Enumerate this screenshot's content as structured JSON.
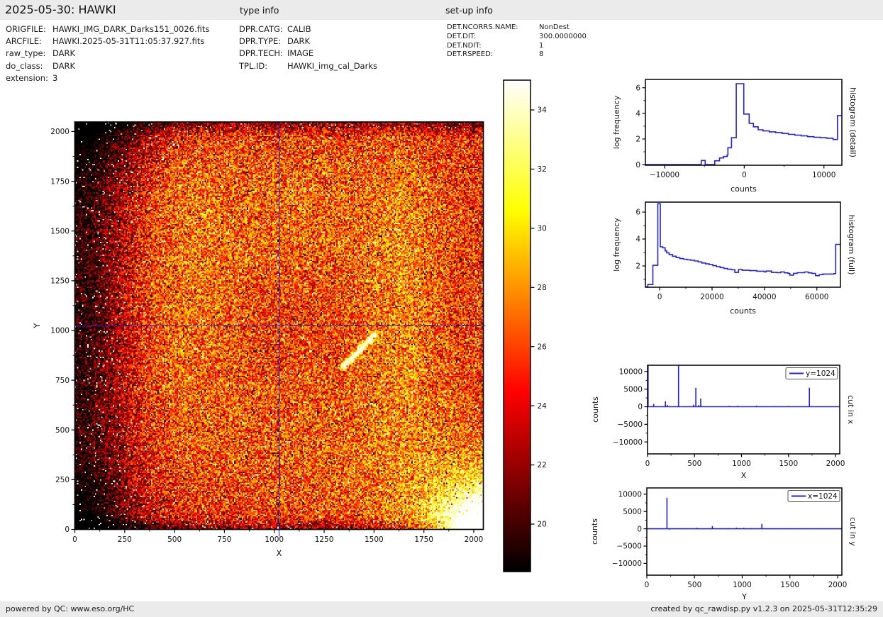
{
  "header": {
    "title": "2025-05-30: HAWKI",
    "type_info_label": "type info",
    "setup_info_label": "set-up info"
  },
  "file_info": {
    "rows": [
      {
        "label": "ORIGFILE:",
        "value": "HAWKI_IMG_DARK_Darks151_0026.fits"
      },
      {
        "label": "ARCFILE:",
        "value": "HAWKI.2025-05-31T11:05:37.927.fits"
      },
      {
        "label": "raw_type:",
        "value": "DARK"
      },
      {
        "label": "do_class:",
        "value": "DARK"
      },
      {
        "label": "extension:",
        "value": "3"
      }
    ]
  },
  "type_info": {
    "rows": [
      {
        "label": "DPR.CATG:",
        "value": "CALIB"
      },
      {
        "label": "DPR.TYPE:",
        "value": "DARK"
      },
      {
        "label": "DPR.TECH:",
        "value": "IMAGE"
      },
      {
        "label": "TPL.ID:",
        "value": "HAWKI_img_cal_Darks"
      }
    ]
  },
  "setup_info": {
    "rows": [
      {
        "label": "DET.NCORRS.NAME:",
        "value": "NonDest"
      },
      {
        "label": "DET.DIT:",
        "value": "300.0000000"
      },
      {
        "label": "DET.NDIT:",
        "value": "1"
      },
      {
        "label": "DET.RSPEED:",
        "value": "8"
      }
    ]
  },
  "footer": {
    "left": "powered by QC: www.eso.org/HC",
    "right": "created by qc_rawdisp.py v1.2.3 on 2025-05-31T12:35:29"
  },
  "colors": {
    "line_blue": "#2222dd",
    "crosshair_blue": "#2222cc",
    "bar_gray": "#ebebeb",
    "axis_black": "#000000"
  },
  "chart_data": [
    {
      "id": "raw_frame",
      "type": "heatmap",
      "xlabel": "X",
      "ylabel": "Y",
      "xlim": [
        0,
        2048
      ],
      "ylim": [
        0,
        2048
      ],
      "xticks": [
        0,
        250,
        500,
        750,
        1000,
        1250,
        1500,
        1750,
        2000
      ],
      "yticks": [
        0,
        250,
        500,
        750,
        1000,
        1250,
        1500,
        1750,
        2000
      ],
      "xticks_minor": [
        125,
        375,
        625,
        875,
        1125,
        1375,
        1625,
        1875
      ],
      "yticks_minor": [
        125,
        375,
        625,
        875,
        1125,
        1375,
        1625,
        1875
      ],
      "colormap": "hot",
      "crosshair": {
        "x": 1024,
        "y": 1024
      },
      "colorbar": {
        "ticks": [
          20,
          22,
          24,
          26,
          28,
          30,
          32,
          34
        ],
        "vmin": 18.4,
        "vmax": 35.0
      },
      "features": [
        "noisy dark frame, orange/red mottled field with hot-pixel speckles",
        "dark band along left edge and dark top/bottom borders",
        "dark top-left and bottom-left corners",
        "bright vertical band around x=350-800",
        "bright band near x=1650",
        "saturated white blob in bottom-right corner",
        "diagonal bright streak from about (1350,820) to (1505,975)"
      ]
    },
    {
      "id": "hist_detail",
      "type": "line",
      "side_label": "histogram (detail)",
      "xlabel": "counts",
      "ylabel": "log frequency",
      "xlim": [
        -12400,
        12250
      ],
      "ylim": [
        -0.05,
        6.65
      ],
      "xticks": [
        -10000,
        0,
        10000
      ],
      "xticks_minor": [
        -5000,
        5000
      ],
      "yticks": [
        0,
        2,
        4,
        6
      ],
      "yticks_minor": [
        1,
        3,
        5
      ],
      "series": [
        {
          "name": "histogram",
          "points": [
            [
              -12400,
              0
            ],
            [
              -5400,
              0
            ],
            [
              -5400,
              0.32
            ],
            [
              -4900,
              0.32
            ],
            [
              -4900,
              0
            ],
            [
              -3700,
              0
            ],
            [
              -3700,
              0.3
            ],
            [
              -3100,
              0.3
            ],
            [
              -3100,
              0.52
            ],
            [
              -2600,
              0.52
            ],
            [
              -2600,
              0.63
            ],
            [
              -2150,
              0.63
            ],
            [
              -2150,
              0.74
            ],
            [
              -2050,
              0.74
            ],
            [
              -2050,
              1.32
            ],
            [
              -1600,
              1.32
            ],
            [
              -1600,
              2.1
            ],
            [
              -1000,
              2.1
            ],
            [
              -1000,
              6.32
            ],
            [
              -60,
              6.32
            ],
            [
              -60,
              3.95
            ],
            [
              620,
              3.95
            ],
            [
              620,
              3.22
            ],
            [
              1150,
              3.22
            ],
            [
              1150,
              2.95
            ],
            [
              1750,
              2.95
            ],
            [
              1750,
              2.72
            ],
            [
              2350,
              2.72
            ],
            [
              2350,
              2.63
            ],
            [
              3150,
              2.63
            ],
            [
              3150,
              2.56
            ],
            [
              3950,
              2.56
            ],
            [
              3950,
              2.5
            ],
            [
              4750,
              2.5
            ],
            [
              4750,
              2.43
            ],
            [
              5550,
              2.43
            ],
            [
              5550,
              2.36
            ],
            [
              6350,
              2.36
            ],
            [
              6350,
              2.3
            ],
            [
              7150,
              2.3
            ],
            [
              7150,
              2.24
            ],
            [
              7950,
              2.24
            ],
            [
              7950,
              2.18
            ],
            [
              8750,
              2.18
            ],
            [
              8750,
              2.13
            ],
            [
              9550,
              2.13
            ],
            [
              9550,
              2.1
            ],
            [
              10350,
              2.1
            ],
            [
              10350,
              2.06
            ],
            [
              11150,
              2.06
            ],
            [
              11150,
              1.96
            ],
            [
              11700,
              1.96
            ],
            [
              11700,
              3.82
            ],
            [
              12250,
              3.82
            ]
          ]
        }
      ]
    },
    {
      "id": "hist_full",
      "type": "line",
      "side_label": "histogram (full)",
      "xlabel": "counts",
      "ylabel": "log frequency",
      "xlim": [
        -5430,
        69000
      ],
      "ylim": [
        0.42,
        6.74
      ],
      "xticks": [
        0,
        20000,
        40000,
        60000
      ],
      "xticks_minor": [
        10000,
        30000,
        50000
      ],
      "yticks": [
        2,
        4,
        6
      ],
      "yticks_minor": [
        1,
        3,
        5
      ],
      "series": [
        {
          "name": "histogram",
          "points": [
            [
              -5400,
              0.45
            ],
            [
              -4500,
              0.45
            ],
            [
              -4500,
              0.62
            ],
            [
              -2600,
              0.62
            ],
            [
              -2600,
              2.05
            ],
            [
              -700,
              2.05
            ],
            [
              -700,
              6.62
            ],
            [
              250,
              6.62
            ],
            [
              250,
              3.42
            ],
            [
              1200,
              3.42
            ],
            [
              1200,
              3.35
            ],
            [
              2100,
              3.35
            ],
            [
              2100,
              3.12
            ],
            [
              2700,
              3.12
            ],
            [
              2700,
              2.98
            ],
            [
              3600,
              2.98
            ],
            [
              3600,
              2.85
            ],
            [
              4900,
              2.85
            ],
            [
              4900,
              2.72
            ],
            [
              6300,
              2.72
            ],
            [
              6300,
              2.62
            ],
            [
              7700,
              2.62
            ],
            [
              7700,
              2.55
            ],
            [
              9100,
              2.55
            ],
            [
              9100,
              2.5
            ],
            [
              10500,
              2.5
            ],
            [
              10500,
              2.46
            ],
            [
              11900,
              2.46
            ],
            [
              11900,
              2.42
            ],
            [
              13300,
              2.42
            ],
            [
              13300,
              2.37
            ],
            [
              14700,
              2.37
            ],
            [
              14700,
              2.3
            ],
            [
              16100,
              2.3
            ],
            [
              16100,
              2.22
            ],
            [
              17500,
              2.22
            ],
            [
              17500,
              2.16
            ],
            [
              18900,
              2.16
            ],
            [
              18900,
              2.1
            ],
            [
              20300,
              2.1
            ],
            [
              20300,
              2.02
            ],
            [
              21700,
              2.02
            ],
            [
              21700,
              1.95
            ],
            [
              23100,
              1.95
            ],
            [
              23100,
              1.88
            ],
            [
              24500,
              1.88
            ],
            [
              24500,
              1.81
            ],
            [
              25900,
              1.81
            ],
            [
              25900,
              1.76
            ],
            [
              27300,
              1.76
            ],
            [
              27300,
              1.72
            ],
            [
              28700,
              1.72
            ],
            [
              28700,
              1.52
            ],
            [
              30100,
              1.52
            ],
            [
              30100,
              1.74
            ],
            [
              31500,
              1.74
            ],
            [
              31500,
              1.68
            ],
            [
              34300,
              1.68
            ],
            [
              34300,
              1.65
            ],
            [
              37100,
              1.65
            ],
            [
              37100,
              1.61
            ],
            [
              39900,
              1.61
            ],
            [
              39900,
              1.55
            ],
            [
              40600,
              1.55
            ],
            [
              40600,
              1.62
            ],
            [
              42700,
              1.62
            ],
            [
              42700,
              1.52
            ],
            [
              44800,
              1.52
            ],
            [
              44800,
              1.5
            ],
            [
              46200,
              1.5
            ],
            [
              46200,
              1.56
            ],
            [
              47600,
              1.56
            ],
            [
              47600,
              1.49
            ],
            [
              49000,
              1.49
            ],
            [
              49000,
              1.44
            ],
            [
              49700,
              1.44
            ],
            [
              49700,
              1.32
            ],
            [
              51100,
              1.32
            ],
            [
              51100,
              1.45
            ],
            [
              52500,
              1.45
            ],
            [
              52500,
              1.5
            ],
            [
              55300,
              1.5
            ],
            [
              55300,
              1.55
            ],
            [
              56700,
              1.55
            ],
            [
              56700,
              1.49
            ],
            [
              58100,
              1.49
            ],
            [
              58100,
              1.44
            ],
            [
              59500,
              1.44
            ],
            [
              59500,
              1.28
            ],
            [
              60900,
              1.28
            ],
            [
              60900,
              1.35
            ],
            [
              62300,
              1.35
            ],
            [
              62300,
              1.4
            ],
            [
              66500,
              1.4
            ],
            [
              66500,
              1.43
            ],
            [
              67200,
              1.43
            ],
            [
              67200,
              3.6
            ],
            [
              69000,
              3.6
            ]
          ]
        }
      ]
    },
    {
      "id": "cut_x",
      "type": "line",
      "side_label": "cut in x",
      "xlabel": "X",
      "ylabel": "counts",
      "legend": "y=1024",
      "xlim": [
        0,
        2045
      ],
      "ylim": [
        -13400,
        11800
      ],
      "xticks": [
        0,
        500,
        1000,
        1500,
        2000
      ],
      "xticks_minor": [
        250,
        750,
        1250,
        1750
      ],
      "yticks": [
        -10000,
        -5000,
        0,
        5000,
        10000
      ],
      "yticks_minor": [
        -7500,
        -2500,
        2500,
        7500
      ],
      "baseline": 0,
      "spikes": [
        [
          6,
          12800
        ],
        [
          66,
          800
        ],
        [
          190,
          1550
        ],
        [
          212,
          500
        ],
        [
          330,
          12800
        ],
        [
          490,
          600
        ],
        [
          514,
          5400
        ],
        [
          545,
          500
        ],
        [
          566,
          2350
        ],
        [
          870,
          250
        ],
        [
          960,
          250
        ],
        [
          1160,
          300
        ],
        [
          1350,
          200
        ],
        [
          1500,
          200
        ],
        [
          1722,
          5400
        ],
        [
          1800,
          150
        ]
      ]
    },
    {
      "id": "cut_y",
      "type": "line",
      "side_label": "cut in y",
      "xlabel": "Y",
      "ylabel": "counts",
      "legend": "x=1024",
      "xlim": [
        0,
        2045
      ],
      "ylim": [
        -13400,
        11800
      ],
      "xticks": [
        0,
        500,
        1000,
        1500,
        2000
      ],
      "xticks_minor": [
        250,
        750,
        1250,
        1750
      ],
      "yticks": [
        -10000,
        -5000,
        0,
        5000,
        10000
      ],
      "yticks_minor": [
        -7500,
        -2500,
        2500,
        7500
      ],
      "baseline": 0,
      "spikes": [
        [
          111,
          150
        ],
        [
          211,
          9000
        ],
        [
          240,
          -250
        ],
        [
          525,
          300
        ],
        [
          687,
          800
        ],
        [
          853,
          250
        ],
        [
          941,
          350
        ],
        [
          1017,
          300
        ],
        [
          1093,
          200
        ],
        [
          1206,
          1400
        ],
        [
          1290,
          150
        ]
      ]
    }
  ]
}
